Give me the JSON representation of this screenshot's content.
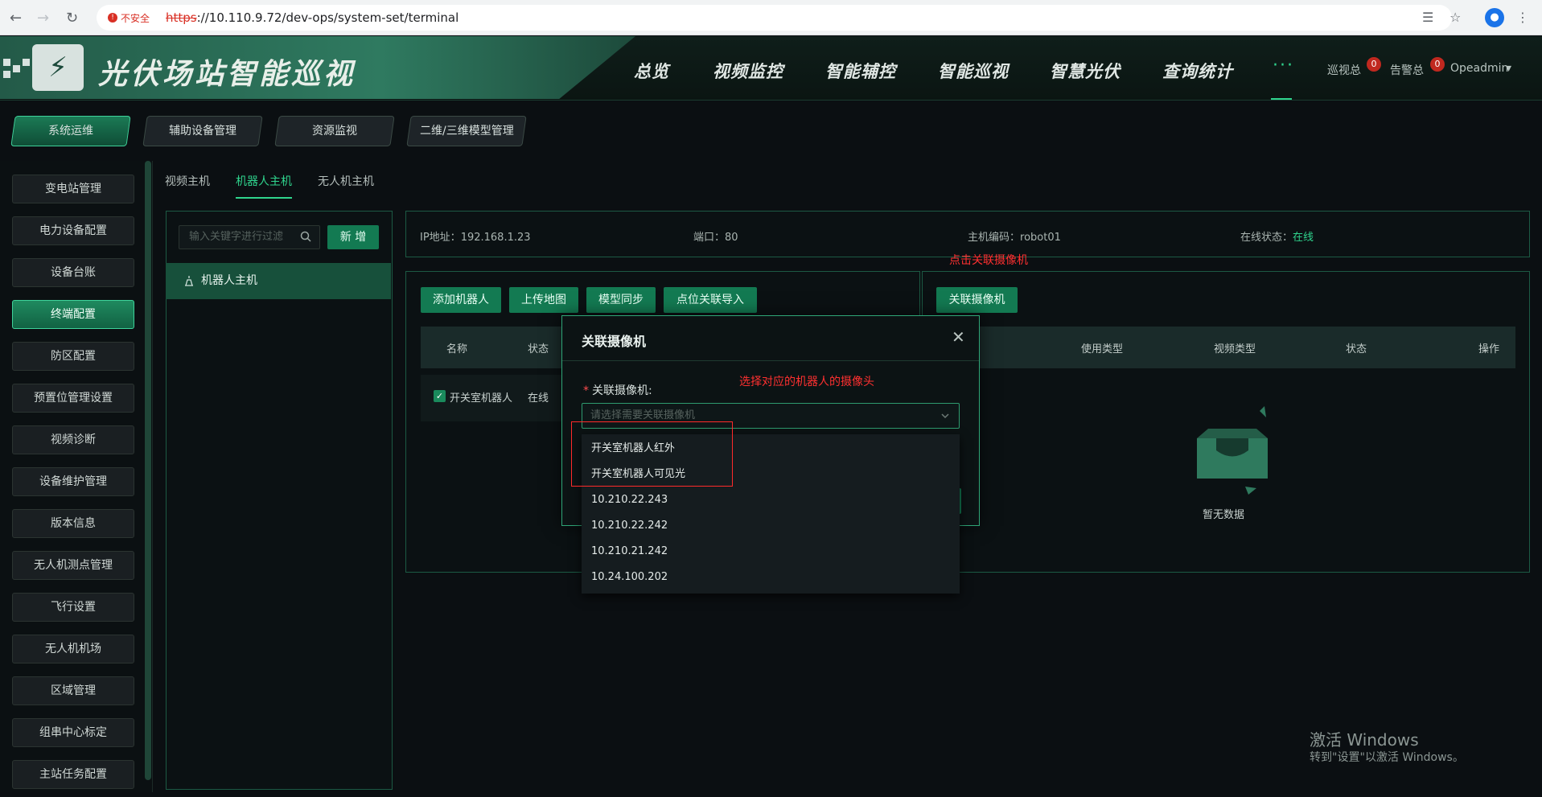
{
  "browser": {
    "insecure_label": "不安全",
    "url_scheme": "https",
    "url_rest": "://10.110.9.72/dev-ops/system-set/terminal"
  },
  "header": {
    "app_title": "光伏场站智能巡视",
    "nav": [
      "总览",
      "视频监控",
      "智能辅控",
      "智能巡视",
      "智慧光伏",
      "查询统计"
    ],
    "more": "···",
    "patrol_label": "巡视总",
    "patrol_count": "0",
    "alarm_label": "告警总",
    "alarm_count": "0",
    "user": "Opeadmin"
  },
  "subtabs": [
    "系统运维",
    "辅助设备管理",
    "资源监视",
    "二维/三维模型管理"
  ],
  "sidebar": {
    "items": [
      "变电站管理",
      "电力设备配置",
      "设备台账",
      "终端配置",
      "防区配置",
      "预置位管理设置",
      "视频诊断",
      "设备维护管理",
      "版本信息",
      "无人机测点管理",
      "飞行设置",
      "无人机机场",
      "区域管理",
      "组串中心标定",
      "主站任务配置"
    ],
    "active_index": 3
  },
  "inner_tabs": [
    "视频主机",
    "机器人主机",
    "无人机主机"
  ],
  "left_panel": {
    "search_placeholder": "输入关键字进行过滤",
    "add_button": "新 增",
    "tree_item": "机器人主机"
  },
  "info": {
    "ip_label": "IP地址：",
    "ip_value": "192.168.1.23",
    "port_label": "端口：",
    "port_value": "80",
    "code_label": "主机编码：",
    "code_value": "robot01",
    "status_label": "在线状态：",
    "status_value": "在线"
  },
  "robot_panel": {
    "buttons": [
      "添加机器人",
      "上传地图",
      "模型同步",
      "点位关联导入"
    ],
    "headers": [
      "名称",
      "状态"
    ],
    "row_name": "开关室机器人",
    "row_status": "在线"
  },
  "camera_panel": {
    "button": "关联摄像机",
    "headers": [
      "使用类型",
      "视频类型",
      "状态",
      "操作"
    ],
    "empty_text": "暂无数据"
  },
  "annotations": {
    "click_hint": "点击关联摄像机",
    "select_hint": "选择对应的机器人的摄像头"
  },
  "modal": {
    "title": "关联摄像机",
    "field_label": "关联摄像机:",
    "placeholder": "请选择需要关联摄像机",
    "options": [
      "开关室机器人红外",
      "开关室机器人可见光",
      "10.210.22.243",
      "10.210.22.242",
      "10.210.21.242",
      "10.24.100.202"
    ]
  },
  "watermark": {
    "line1": "激活 Windows",
    "line2": "转到\"设置\"以激活 Windows。"
  },
  "colors": {
    "accent": "#2fd48d",
    "active_bg": "#137a52",
    "annotation": "#ff3030"
  }
}
